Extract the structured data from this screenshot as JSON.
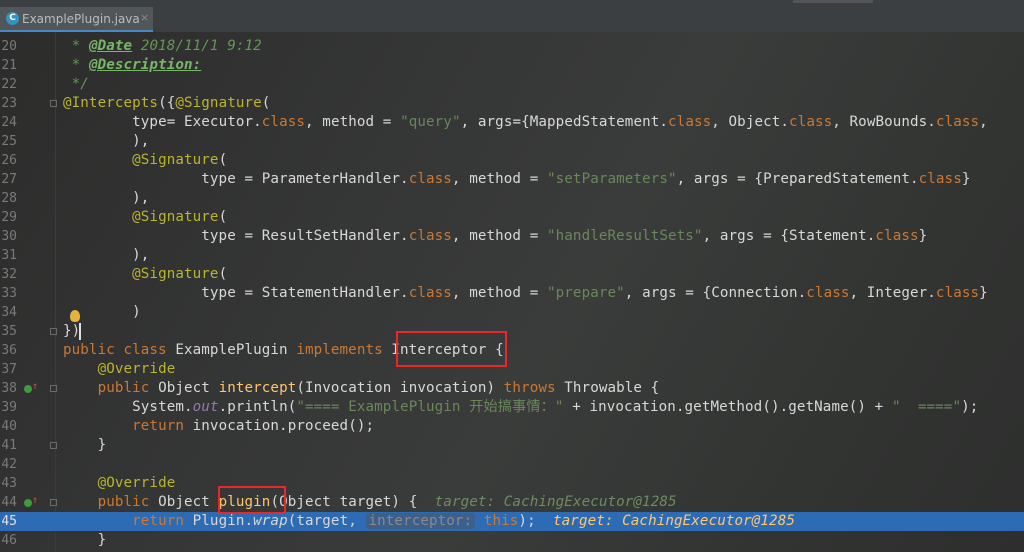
{
  "tab": {
    "filename": "ExamplePlugin.java",
    "close": "×",
    "icon": "C"
  },
  "lines": [
    {
      "no": "20",
      "text": ""
    },
    {
      "no": "21",
      "text": ""
    },
    {
      "no": "22",
      "text": ""
    },
    {
      "no": "23",
      "text": ""
    },
    {
      "no": "24",
      "text": ""
    },
    {
      "no": "25",
      "text": ""
    },
    {
      "no": "26",
      "text": ""
    },
    {
      "no": "27",
      "text": ""
    },
    {
      "no": "28",
      "text": ""
    },
    {
      "no": "29",
      "text": ""
    },
    {
      "no": "30",
      "text": ""
    },
    {
      "no": "31",
      "text": ""
    },
    {
      "no": "32",
      "text": ""
    },
    {
      "no": "33",
      "text": ""
    },
    {
      "no": "34",
      "text": ""
    },
    {
      "no": "35",
      "text": ""
    },
    {
      "no": "36",
      "text": ""
    },
    {
      "no": "37",
      "text": ""
    },
    {
      "no": "38",
      "text": ""
    },
    {
      "no": "39",
      "text": ""
    },
    {
      "no": "40",
      "text": ""
    },
    {
      "no": "41",
      "text": ""
    },
    {
      "no": "42",
      "text": ""
    },
    {
      "no": "43",
      "text": ""
    },
    {
      "no": "44",
      "text": ""
    },
    {
      "no": "45",
      "text": ""
    },
    {
      "no": "46",
      "text": ""
    }
  ],
  "code": {
    "l20": {
      "star": " * ",
      "tag": "@Date",
      "rest": " 2018/11/1 9:12"
    },
    "l21": {
      "star": " * ",
      "tag": "@Description:"
    },
    "l22": " */",
    "l23": {
      "ann": "@Intercepts",
      "p1": "({",
      "ann2": "@Signature",
      "p2": "("
    },
    "l24": {
      "i": "        ",
      "a": "type",
      "b": "= Executor.",
      "c": "class",
      "d": ", ",
      "e": "method",
      "f": " = ",
      "g": "\"query\"",
      "h": ", ",
      "k": "args",
      "m": "={MappedStatement.",
      "n": "class",
      "o": ", Object.",
      "p": "class",
      "q": ", RowBounds.",
      "r": "class",
      "s": ","
    },
    "l25": "        ),",
    "l26": {
      "i": "        ",
      "ann": "@Signature",
      "p": "("
    },
    "l27": {
      "i": "                ",
      "a": "type",
      "b": " = ParameterHandler.",
      "c": "class",
      "d": ", ",
      "e": "method",
      "f": " = ",
      "g": "\"setParameters\"",
      "h": ", ",
      "k": "args",
      "m": " = {PreparedStatement.",
      "n": "class",
      "o": "}"
    },
    "l28": "        ),",
    "l29": {
      "i": "        ",
      "ann": "@Signature",
      "p": "("
    },
    "l30": {
      "i": "                ",
      "a": "type",
      "b": " = ResultSetHandler.",
      "c": "class",
      "d": ", ",
      "e": "method",
      "f": " = ",
      "g": "\"handleResultSets\"",
      "h": ", ",
      "k": "args",
      "m": " = {Statement.",
      "n": "class",
      "o": "}"
    },
    "l31": "        ),",
    "l32": {
      "i": "        ",
      "ann": "@Signature",
      "p": "("
    },
    "l33": {
      "i": "                ",
      "a": "type",
      "b": " = StatementHandler.",
      "c": "class",
      "d": ", ",
      "e": "method",
      "f": " = ",
      "g": "\"prepare\"",
      "h": ", ",
      "k": "args",
      "m": " = {Connection.",
      "n": "class",
      "o": ", Integer.",
      "p": "class",
      "q": "}"
    },
    "l34": "        )",
    "l35": "})",
    "l36": {
      "kw": "public class",
      "name": " ExamplePlugin ",
      "impl": "implements",
      "iface": " Interceptor ",
      "brace": "{"
    },
    "l37": {
      "i": "    ",
      "ann": "@Override"
    },
    "l38": {
      "i": "    ",
      "kw": "public",
      "t": " Object ",
      "fn": "intercept",
      "p": "(Invocation invocation) ",
      "thr": "throws",
      "ex": " Throwable {"
    },
    "l39": {
      "i": "        ",
      "a": "System.",
      "out": "out",
      "b": ".println(",
      "s": "\"==== ExamplePlugin 开始搞事情：\"",
      "c": " + invocation.getMethod().getName() + ",
      "s2": "\"  ====\"",
      "d": ");"
    },
    "l40": {
      "i": "        ",
      "kw": "return",
      "rest": " invocation.proceed();"
    },
    "l41": "    }",
    "l42": "",
    "l43": {
      "i": "    ",
      "ann": "@Override"
    },
    "l44": {
      "i": "    ",
      "kw": "public",
      "t": " Object ",
      "fn": "plugin",
      "p": "(Object target) {",
      "dbg": "target: CachingExecutor@1285"
    },
    "l45": {
      "i": "        ",
      "kw": "return",
      "a": " Plugin.",
      "fn": "wrap",
      "b": "(target, ",
      "hint": "interceptor:",
      "this": " this",
      "c": ");",
      "dbg": "target: CachingExecutor@1285"
    },
    "l46": "    }"
  },
  "colors": {
    "keyword": "#cc7832",
    "annotation": "#bbb529",
    "string": "#6a8759",
    "field": "#9876aa",
    "method": "#ffc66d",
    "highlight": "#e8282a",
    "current_line": "#2d6cb5"
  }
}
